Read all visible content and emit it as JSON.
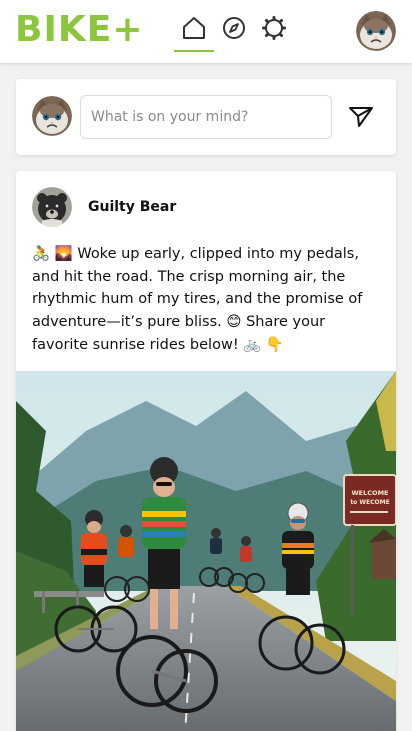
{
  "app": {
    "logo_text": "BIKE+"
  },
  "nav": {
    "icons": [
      "home-icon",
      "compass-icon",
      "settings-gear-icon"
    ],
    "active": "home-icon",
    "accent_color": "#8cc63f"
  },
  "user": {
    "avatar": "grumpy-cat-avatar"
  },
  "composer": {
    "placeholder": "What is on your mind?",
    "value": "",
    "send_icon": "paper-plane-icon"
  },
  "post": {
    "author": "Guilty Bear",
    "author_avatar": "bear-avatar",
    "text": "🚴 🌄 Woke up early, clipped into my pedals, and hit the road. The crisp morning air, the rhythmic hum of my tires, and the promise of adventure—it’s pure bliss. 😊 Share your favorite sunrise rides below! 🚲 👇",
    "image": {
      "subject": "group of cyclists riding on a mountain road",
      "sign_text": [
        "WELCOME",
        "to WECOME"
      ]
    }
  }
}
